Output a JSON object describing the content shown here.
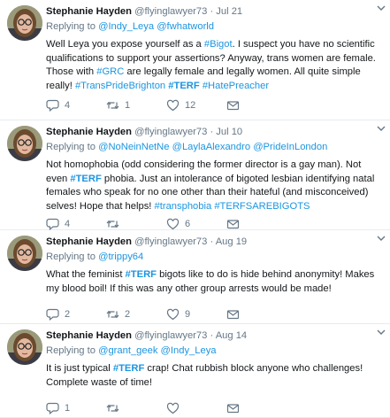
{
  "tweets": [
    {
      "author": {
        "name": "Stephanie Hayden",
        "handle": "@flyinglawyer73"
      },
      "separator": "·",
      "date": "Jul 21",
      "replying_label": "Replying to",
      "replying_to": [
        "@Indy_Leya",
        "@fwhatworld"
      ],
      "text": [
        {
          "t": "Well Leya you expose yourself as a ",
          "k": "plain"
        },
        {
          "t": "#Bigot",
          "k": "link"
        },
        {
          "t": ". I suspect you have no scientific qualifications to support your assertions? Anyway, trans women are female. Those with ",
          "k": "plain"
        },
        {
          "t": "#GRC",
          "k": "link"
        },
        {
          "t": " are legally female and legally women. All quite simple really! ",
          "k": "plain"
        },
        {
          "t": "#TransPrideBrighton",
          "k": "link"
        },
        {
          "t": " ",
          "k": "plain"
        },
        {
          "t": "#TERF",
          "k": "linkbold"
        },
        {
          "t": " ",
          "k": "plain"
        },
        {
          "t": "#HatePreacher",
          "k": "link"
        }
      ],
      "reply_count": "4",
      "retweet_count": "1",
      "like_count": "12"
    },
    {
      "author": {
        "name": "Stephanie Hayden",
        "handle": "@flyinglawyer73"
      },
      "separator": "·",
      "date": "Jul 10",
      "replying_label": "Replying to",
      "replying_to": [
        "@NoNeinNetNe",
        "@LaylaAlexandro",
        "@PrideInLondon"
      ],
      "text": [
        {
          "t": "Not homophobia (odd considering the former director is a gay man). Not even ",
          "k": "plain"
        },
        {
          "t": "#TERF",
          "k": "linkbold"
        },
        {
          "t": " phobia. Just an intolerance of bigoted lesbian identifying natal females who speak for no one other than their hateful (and misconceived) selves! Hope that helps! ",
          "k": "plain"
        },
        {
          "t": "#transphobia",
          "k": "link"
        },
        {
          "t": " ",
          "k": "plain"
        },
        {
          "t": "#TERFSAREBIGOTS",
          "k": "link"
        }
      ],
      "reply_count": "4",
      "retweet_count": "",
      "like_count": "6"
    },
    {
      "author": {
        "name": "Stephanie Hayden",
        "handle": "@flyinglawyer73"
      },
      "separator": "·",
      "date": "Aug 19",
      "replying_label": "Replying to",
      "replying_to": [
        "@trippy64"
      ],
      "text": [
        {
          "t": "What the feminist ",
          "k": "plain"
        },
        {
          "t": "#TERF",
          "k": "linkbold"
        },
        {
          "t": " bigots like to do is hide behind anonymity! Makes my blood boil! If this was any other group arrests would be made!",
          "k": "plain"
        }
      ],
      "reply_count": "2",
      "retweet_count": "2",
      "like_count": "9"
    },
    {
      "author": {
        "name": "Stephanie Hayden",
        "handle": "@flyinglawyer73"
      },
      "separator": "·",
      "date": "Aug 14",
      "replying_label": "Replying to",
      "replying_to": [
        "@grant_geek",
        "@Indy_Leya"
      ],
      "text": [
        {
          "t": "It is just typical ",
          "k": "plain"
        },
        {
          "t": "#TERF",
          "k": "linkbold"
        },
        {
          "t": " crap! Chat rubbish block anyone who challenges! Complete waste of time!",
          "k": "plain"
        }
      ],
      "reply_count": "1",
      "retweet_count": "",
      "like_count": ""
    }
  ],
  "colors": {
    "link": "#1b95e0",
    "muted": "#657786",
    "text": "#14171a",
    "divider": "#e6ecf0"
  },
  "icons": {
    "reply": "reply-icon",
    "retweet": "retweet-icon",
    "like": "heart-icon",
    "menu": "chevron-down-icon"
  }
}
